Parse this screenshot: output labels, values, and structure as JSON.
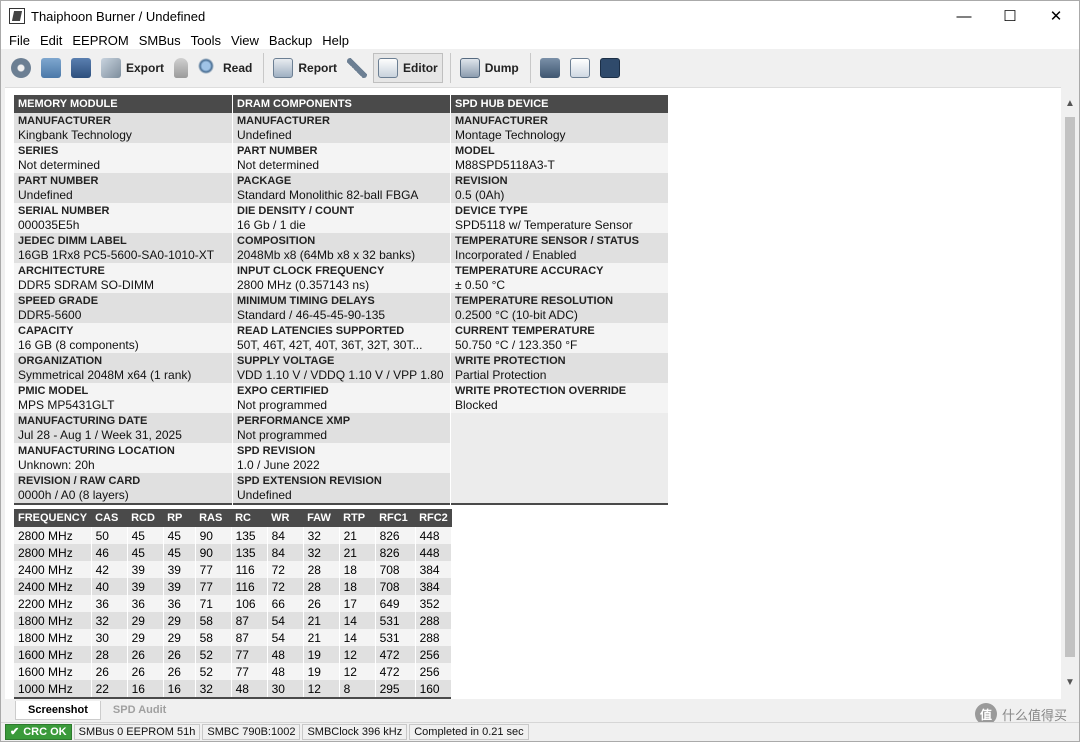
{
  "window": {
    "title": "Thaiphoon Burner / Undefined",
    "minimize": "—",
    "maximize": "☐",
    "close": "✕"
  },
  "menu": [
    "File",
    "Edit",
    "EEPROM",
    "SMBus",
    "Tools",
    "View",
    "Backup",
    "Help"
  ],
  "toolbar": {
    "export_label": "Export",
    "read_label": "Read",
    "report_label": "Report",
    "editor_label": "Editor",
    "dump_label": "Dump"
  },
  "memory_module": {
    "header": "MEMORY MODULE",
    "rows": [
      {
        "label": "MANUFACTURER",
        "value": "Kingbank Technology"
      },
      {
        "label": "SERIES",
        "value": "Not determined"
      },
      {
        "label": "PART NUMBER",
        "value": "Undefined"
      },
      {
        "label": "SERIAL NUMBER",
        "value": "000035E5h"
      },
      {
        "label": "JEDEC DIMM LABEL",
        "value": "16GB 1Rx8 PC5-5600-SA0-1010-XT"
      },
      {
        "label": "ARCHITECTURE",
        "value": "DDR5 SDRAM SO-DIMM"
      },
      {
        "label": "SPEED GRADE",
        "value": "DDR5-5600"
      },
      {
        "label": "CAPACITY",
        "value": "16 GB (8 components)"
      },
      {
        "label": "ORGANIZATION",
        "value": "Symmetrical 2048M x64 (1 rank)"
      },
      {
        "label": "PMIC MODEL",
        "value": "MPS MP5431GLT"
      },
      {
        "label": "MANUFACTURING DATE",
        "value": "Jul 28 - Aug 1 / Week 31, 2025"
      },
      {
        "label": "MANUFACTURING LOCATION",
        "value": "Unknown: 20h"
      },
      {
        "label": "REVISION / RAW CARD",
        "value": "0000h / A0 (8 layers)"
      }
    ]
  },
  "dram_components": {
    "header": "DRAM COMPONENTS",
    "rows": [
      {
        "label": "MANUFACTURER",
        "value": "Undefined"
      },
      {
        "label": "PART NUMBER",
        "value": "Not determined"
      },
      {
        "label": "PACKAGE",
        "value": "Standard Monolithic 82-ball FBGA"
      },
      {
        "label": "DIE DENSITY / COUNT",
        "value": "16 Gb / 1 die"
      },
      {
        "label": "COMPOSITION",
        "value": "2048Mb x8 (64Mb x8 x 32 banks)"
      },
      {
        "label": "INPUT CLOCK FREQUENCY",
        "value": "2800 MHz (0.357143 ns)"
      },
      {
        "label": "MINIMUM TIMING DELAYS",
        "value": "Standard / 46-45-45-90-135"
      },
      {
        "label": "READ LATENCIES SUPPORTED",
        "value": "50T, 46T, 42T, 40T, 36T, 32T, 30T..."
      },
      {
        "label": "SUPPLY VOLTAGE",
        "value": "VDD 1.10 V / VDDQ 1.10 V / VPP 1.80 V"
      },
      {
        "label": "EXPO CERTIFIED",
        "value": "Not programmed"
      },
      {
        "label": "PERFORMANCE XMP",
        "value": "Not programmed"
      },
      {
        "label": "SPD REVISION",
        "value": "1.0 / June 2022"
      },
      {
        "label": "SPD EXTENSION REVISION",
        "value": "Undefined"
      }
    ]
  },
  "spd_hub": {
    "header": "SPD HUB DEVICE",
    "rows": [
      {
        "label": "MANUFACTURER",
        "value": "Montage Technology"
      },
      {
        "label": "MODEL",
        "value": "M88SPD5118A3-T"
      },
      {
        "label": "REVISION",
        "value": "0.5 (0Ah)"
      },
      {
        "label": "DEVICE TYPE",
        "value": "SPD5118 w/ Temperature Sensor"
      },
      {
        "label": "TEMPERATURE SENSOR / STATUS",
        "value": "Incorporated / Enabled"
      },
      {
        "label": "TEMPERATURE ACCURACY",
        "value": "± 0.50 °C"
      },
      {
        "label": "TEMPERATURE RESOLUTION",
        "value": "0.2500 °C (10-bit ADC)"
      },
      {
        "label": "CURRENT TEMPERATURE",
        "value": "50.750 °C / 123.350 °F"
      },
      {
        "label": "WRITE PROTECTION",
        "value": "Partial Protection"
      },
      {
        "label": "WRITE PROTECTION OVERRIDE",
        "value": "Blocked"
      }
    ]
  },
  "timings": {
    "columns": [
      "FREQUENCY",
      "CAS",
      "RCD",
      "RP",
      "RAS",
      "RC",
      "WR",
      "FAW",
      "RTP",
      "RFC1",
      "RFC2"
    ],
    "rows": [
      [
        "2800 MHz",
        "50",
        "45",
        "45",
        "90",
        "135",
        "84",
        "32",
        "21",
        "826",
        "448"
      ],
      [
        "2800 MHz",
        "46",
        "45",
        "45",
        "90",
        "135",
        "84",
        "32",
        "21",
        "826",
        "448"
      ],
      [
        "2400 MHz",
        "42",
        "39",
        "39",
        "77",
        "116",
        "72",
        "28",
        "18",
        "708",
        "384"
      ],
      [
        "2400 MHz",
        "40",
        "39",
        "39",
        "77",
        "116",
        "72",
        "28",
        "18",
        "708",
        "384"
      ],
      [
        "2200 MHz",
        "36",
        "36",
        "36",
        "71",
        "106",
        "66",
        "26",
        "17",
        "649",
        "352"
      ],
      [
        "1800 MHz",
        "32",
        "29",
        "29",
        "58",
        "87",
        "54",
        "21",
        "14",
        "531",
        "288"
      ],
      [
        "1800 MHz",
        "30",
        "29",
        "29",
        "58",
        "87",
        "54",
        "21",
        "14",
        "531",
        "288"
      ],
      [
        "1600 MHz",
        "28",
        "26",
        "26",
        "52",
        "77",
        "48",
        "19",
        "12",
        "472",
        "256"
      ],
      [
        "1600 MHz",
        "26",
        "26",
        "26",
        "52",
        "77",
        "48",
        "19",
        "12",
        "472",
        "256"
      ],
      [
        "1000 MHz",
        "22",
        "16",
        "16",
        "32",
        "48",
        "30",
        "12",
        "8",
        "295",
        "160"
      ]
    ]
  },
  "tabs": {
    "screenshot": "Screenshot",
    "spd_audit": "SPD Audit"
  },
  "status": {
    "crc": "CRC OK",
    "smbus": "SMBus 0 EEPROM 51h",
    "smbc": "SMBC 790B:1002",
    "smbclock": "SMBClock 396 kHz",
    "completed": "Completed in 0.21 sec"
  },
  "watermark": {
    "mark": "值",
    "text": "什么值得买"
  }
}
